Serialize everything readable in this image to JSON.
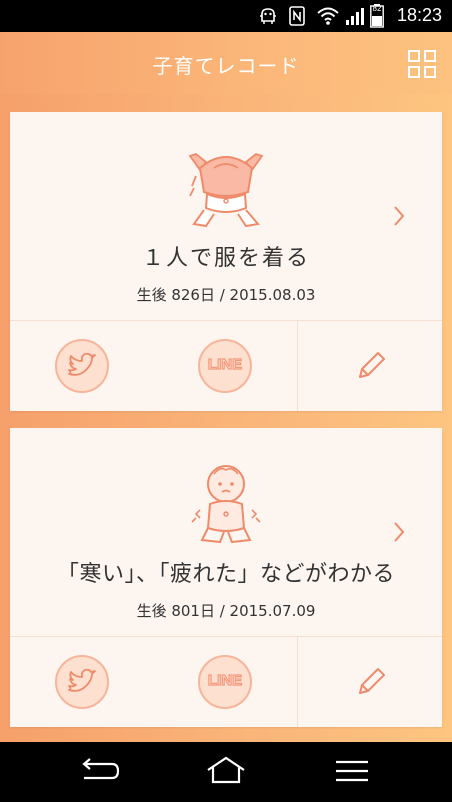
{
  "status_bar": {
    "time": "18:23",
    "battery_level": "82",
    "icons": [
      "android-debug-icon",
      "nfc-icon",
      "wifi-icon",
      "signal-icon",
      "battery-icon"
    ]
  },
  "header": {
    "title": "子育てレコード",
    "menu_icon": "grid-menu-icon"
  },
  "records": [
    {
      "title": "１人で服を着る",
      "subtitle": "生後 826日 / 2015.08.03",
      "illustration": "baby-dressing-illustration",
      "share": {
        "twitter_icon": "twitter-icon",
        "line_label": "LINE"
      },
      "edit_icon": "pencil-icon"
    },
    {
      "title": "「寒い」、「疲れた」などがわかる",
      "subtitle": "生後 801日 / 2015.07.09",
      "illustration": "baby-shivering-illustration",
      "share": {
        "twitter_icon": "twitter-icon",
        "line_label": "LINE"
      },
      "edit_icon": "pencil-icon"
    }
  ],
  "nav_bar": {
    "icons": [
      "back-icon",
      "home-icon",
      "recent-apps-icon"
    ]
  },
  "colors": {
    "accent": "#f7a36d",
    "accent_light": "#fdc27f",
    "icon_stroke": "#ef8a6a",
    "card_bg": "#fdf6f0"
  }
}
